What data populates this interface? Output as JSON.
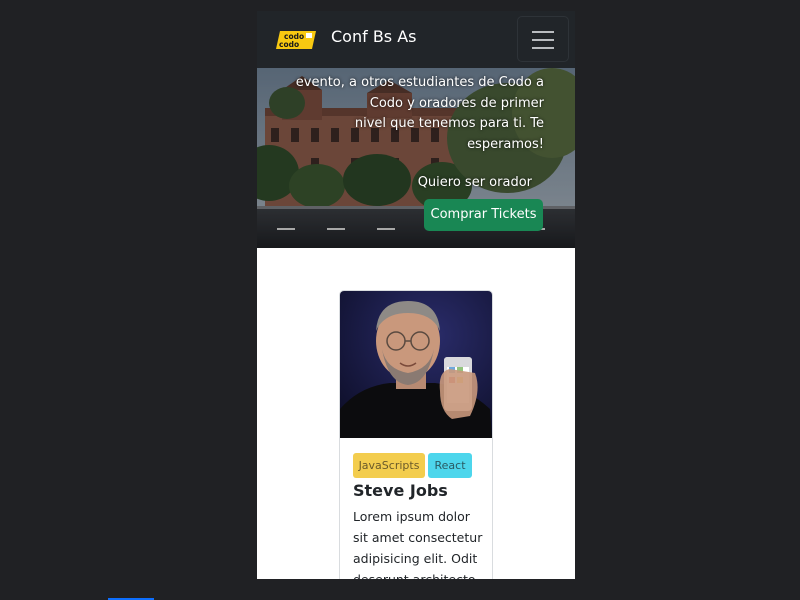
{
  "navbar": {
    "logo_text_top": "codo",
    "logo_text_bottom": "codo",
    "brand": "Conf Bs As"
  },
  "hero": {
    "lines": [
      "evento, a otros estudiantes de Codo a",
      "Codo y oradores de primer",
      "nivel que tenemos para ti. Te",
      "esperamos!"
    ],
    "speaker_link": "Quiero ser orador",
    "tickets_button": "Comprar Tickets"
  },
  "speaker_card": {
    "badges": [
      "JavaScripts",
      "React"
    ],
    "name": "Steve Jobs",
    "text_lines": [
      "Lorem ipsum dolor",
      "sit amet consectetur",
      "adipisicing elit. Odit",
      "deserunt architecto"
    ]
  },
  "colors": {
    "navbar_bg": "#212529",
    "button_green": "#198754",
    "badge_yellow": "#f3cd4e",
    "badge_cyan": "#4dd6ec",
    "logo_yellow": "#f8c911"
  }
}
